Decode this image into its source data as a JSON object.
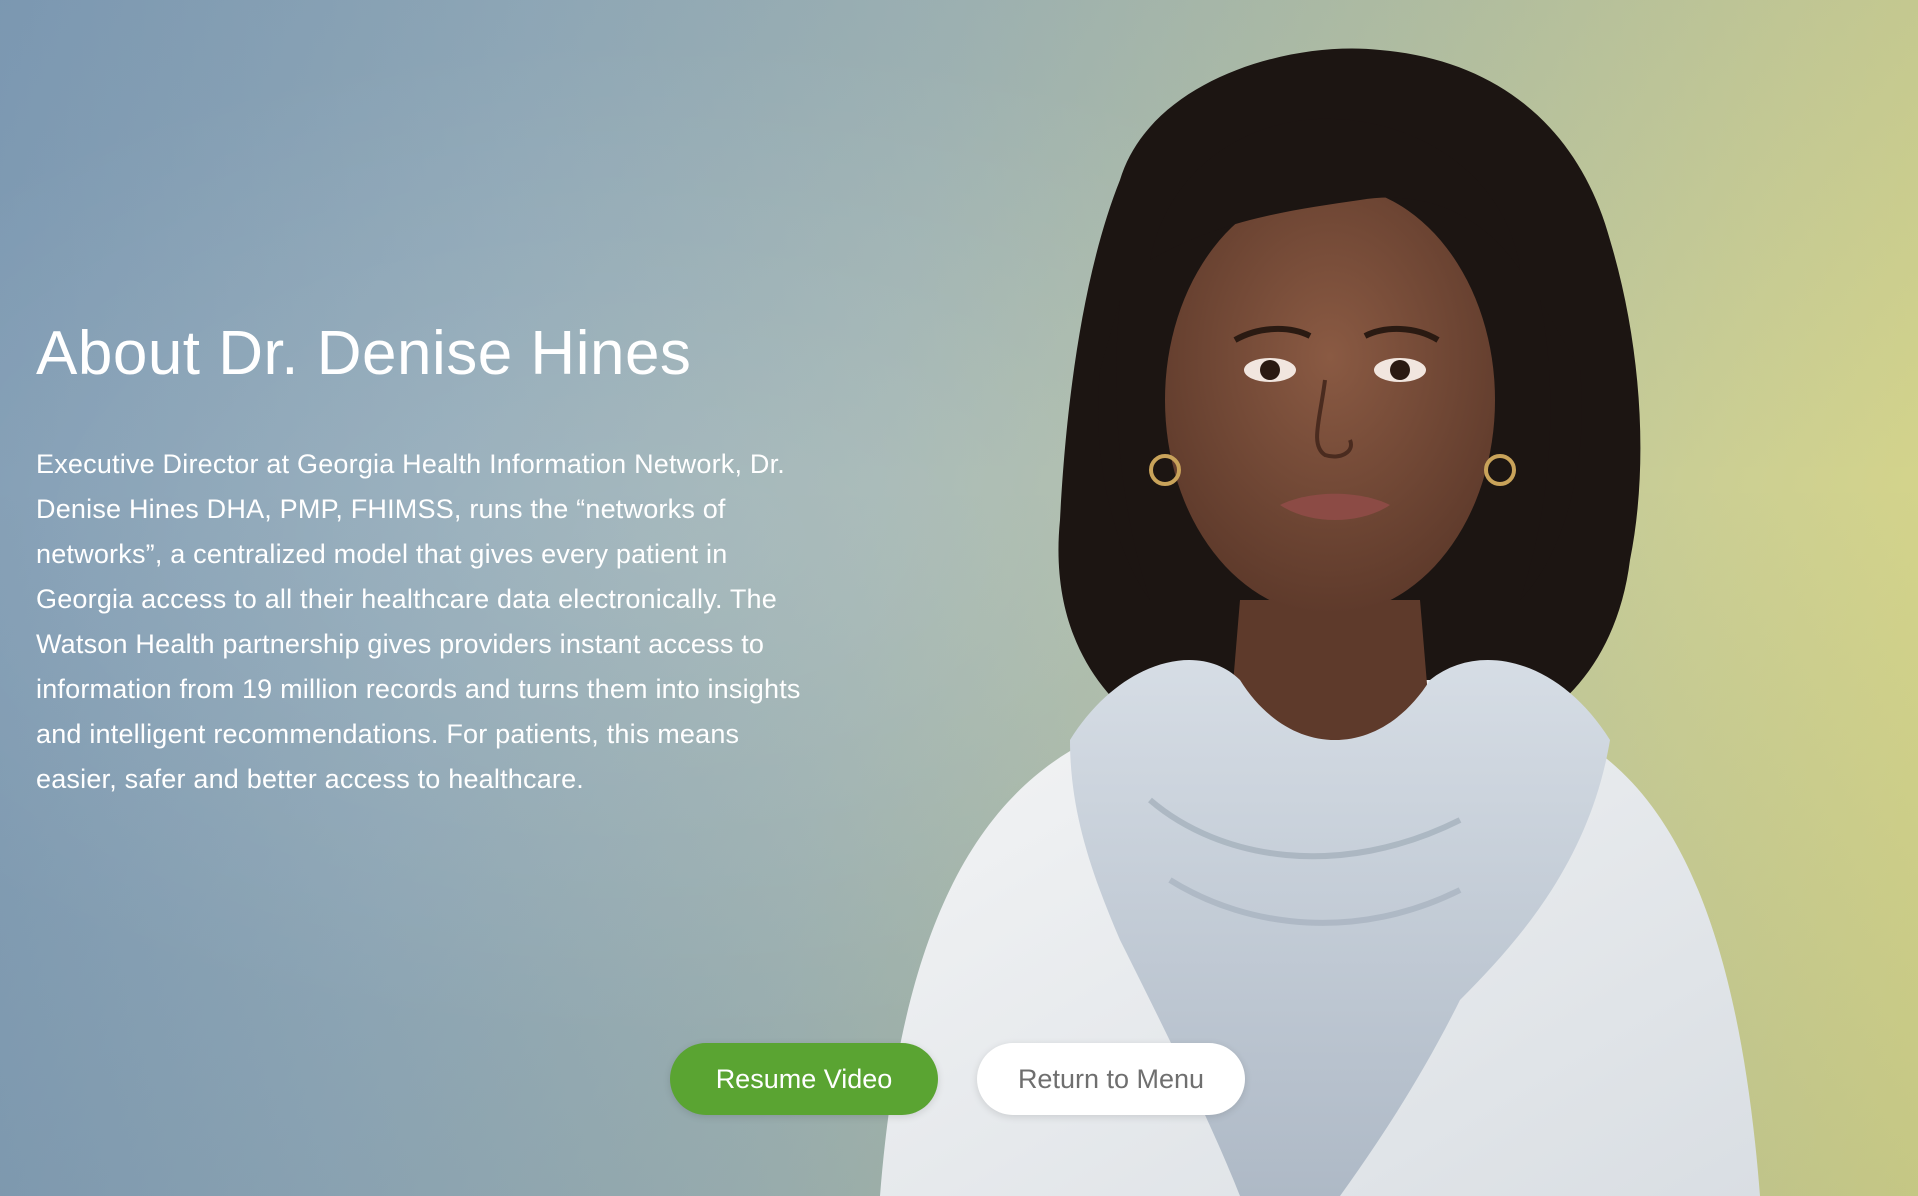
{
  "about": {
    "title": "About Dr. Denise Hines",
    "bio": "Executive Director at Georgia Health Information Network, Dr. Denise Hines DHA, PMP, FHIMSS, runs the “networks of networks”, a centralized model that gives every patient in Georgia access to all their healthcare data electronically. The Watson Health partnership gives providers instant access to information from 19 million records and turns them into insights and intelligent recommendations. For patients, this means easier, safer and better access to healthcare."
  },
  "actions": {
    "resume_label": "Resume Video",
    "menu_label": "Return to Menu"
  },
  "colors": {
    "primary_button": "#5aa432",
    "secondary_button": "#ffffff",
    "background_left": "#7f9bb4",
    "background_right": "#d8d686"
  }
}
